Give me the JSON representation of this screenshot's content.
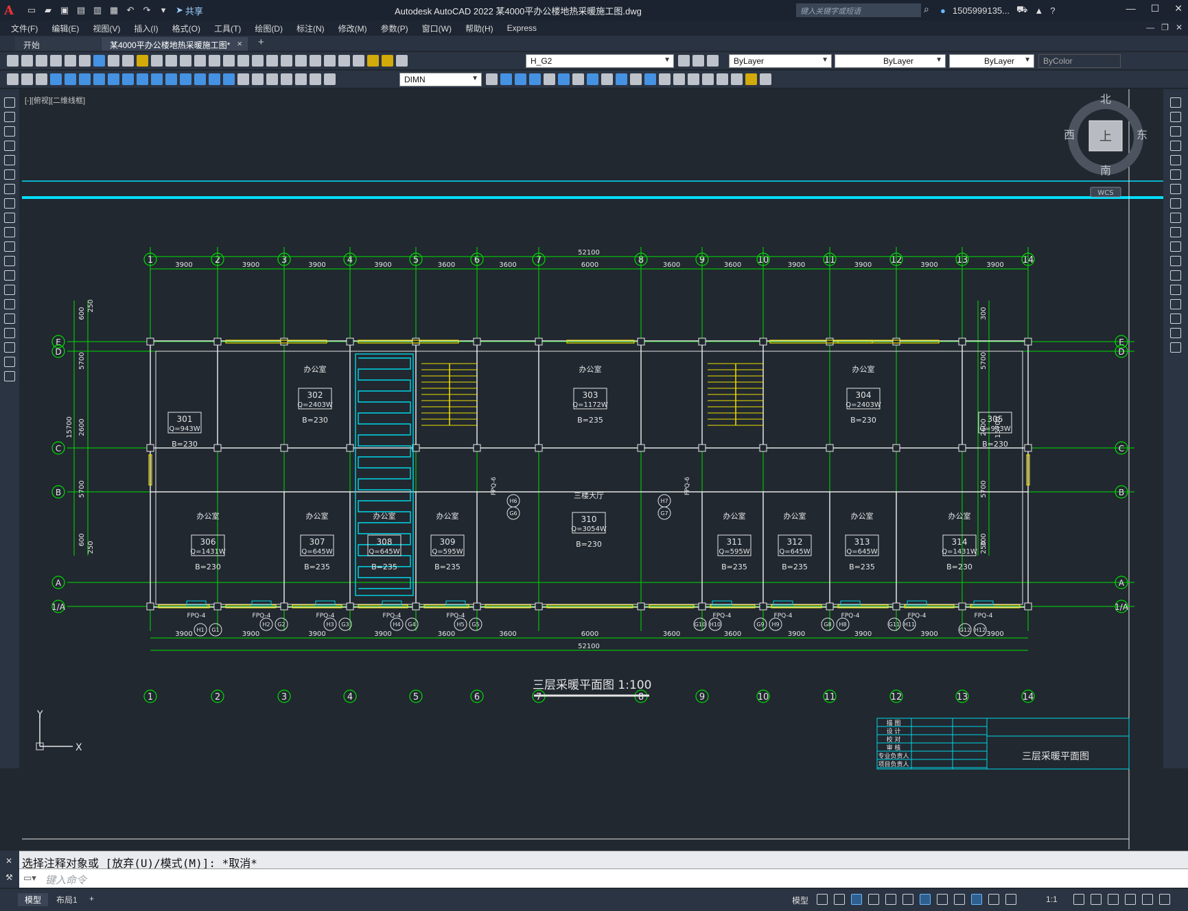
{
  "titlebar": {
    "logo": "A",
    "share_label": "共享",
    "app_title": "Autodesk AutoCAD 2022    某4000平办公楼地热采暖施工图.dwg",
    "search_placeholder": "键入关键字或短语",
    "user": "1505999135...",
    "win_min": "—",
    "win_max": "☐",
    "win_close": "✕"
  },
  "menubar": {
    "items": [
      "文件(F)",
      "编辑(E)",
      "视图(V)",
      "插入(I)",
      "格式(O)",
      "工具(T)",
      "绘图(D)",
      "标注(N)",
      "修改(M)",
      "参数(P)",
      "窗口(W)",
      "帮助(H)",
      "Express"
    ]
  },
  "tabs": {
    "start": "开始",
    "active": "某4000平办公楼地热采暖施工图*",
    "close": "×",
    "add": "+"
  },
  "toolbar": {
    "layer_name": "H_G2",
    "color": "ByLayer",
    "linetype": "ByLayer",
    "lineweight": "ByLayer",
    "plotstyle": "ByColor",
    "dimstyle": "DIMN"
  },
  "viewport": {
    "view_label": "[-][俯视][二维线框]",
    "compass": {
      "north": "北",
      "south": "南",
      "east": "东",
      "west": "西",
      "top": "上",
      "wcs": "WCS"
    },
    "ucs": {
      "x": "X",
      "y": "Y"
    }
  },
  "drawing": {
    "grid_cols": [
      "1",
      "2",
      "3",
      "4",
      "5",
      "6",
      "7",
      "8",
      "9",
      "10",
      "11",
      "12",
      "13",
      "14"
    ],
    "grid_rows": [
      "E",
      "D",
      "C",
      "B",
      "A",
      "1/A"
    ],
    "top_total": "52100",
    "bottom_total": "52100",
    "spans": [
      "3900",
      "3900",
      "3900",
      "3900",
      "3600",
      "3600",
      "6000",
      "3600",
      "3600",
      "3900",
      "3900",
      "3900",
      "3900"
    ],
    "left_dims": [
      "250",
      "600",
      "5700",
      "2600",
      "5700",
      "600",
      "250"
    ],
    "left_total": "15700",
    "right_dims": [
      "300",
      "5700",
      "2600",
      "5700",
      "300",
      "250"
    ],
    "right_total": "15700",
    "rooms_top": [
      {
        "label": "办公室",
        "id": "302",
        "q": "Q=2403W",
        "b": "B=230"
      },
      {
        "label": "办公室",
        "id": "303",
        "q": "Q=1172W",
        "b": "B=235"
      },
      {
        "label": "办公室",
        "id": "304",
        "q": "Q=2403W",
        "b": "B=230"
      }
    ],
    "rooms_wc": [
      {
        "id": "301",
        "q": "Q=943W",
        "b": "B=230"
      },
      {
        "id": "305",
        "q": "Q=943W",
        "b": "B=230"
      }
    ],
    "hall": {
      "label": "三楼大厅",
      "id": "310",
      "q": "Q=3054W",
      "b": "B=230"
    },
    "rooms_bottom": [
      {
        "label": "办公室",
        "id": "306",
        "q": "Q=1431W",
        "b": "B=230"
      },
      {
        "label": "办公室",
        "id": "307",
        "q": "Q=645W",
        "b": "B=235"
      },
      {
        "label": "办公室",
        "id": "308",
        "q": "Q=645W",
        "b": "B=235"
      },
      {
        "label": "办公室",
        "id": "309",
        "q": "Q=595W",
        "b": "B=235"
      },
      {
        "label": "办公室",
        "id": "311",
        "q": "Q=595W",
        "b": "B=235"
      },
      {
        "label": "办公室",
        "id": "312",
        "q": "Q=645W",
        "b": "B=235"
      },
      {
        "label": "办公室",
        "id": "313",
        "q": "Q=645W",
        "b": "B=235"
      },
      {
        "label": "办公室",
        "id": "314",
        "q": "Q=1431W",
        "b": "B=230"
      }
    ],
    "fpq_bottom": [
      "FPQ-4",
      "FPQ-4",
      "FPQ-4",
      "FPQ-4",
      "FPQ-4",
      "FPQ-4",
      "FPQ-4",
      "FPQ-4",
      "FPQ-4",
      "FPQ-4"
    ],
    "fpq_mid": "FPQ-6",
    "pipe_tags": [
      "H1",
      "G1",
      "H2",
      "G2",
      "H3",
      "G3",
      "H4",
      "G4",
      "H5",
      "G5",
      "G10",
      "H10",
      "G9",
      "H9",
      "G8",
      "H8",
      "G11",
      "H11",
      "G12",
      "H12",
      "H6",
      "G6",
      "H7",
      "G7"
    ],
    "plan_title": "三层采暖平面图 1:100"
  },
  "titleblock": {
    "rows": [
      "描 图",
      "设 计",
      "校 对",
      "审 核",
      "专业负责人",
      "项目负责人"
    ],
    "drawing_name": "三层采暖平面图"
  },
  "command": {
    "history": "选择注释对象或 [放弃(U)/模式(M)]: *取消*",
    "placeholder": "键入命令"
  },
  "statusbar": {
    "tabs": [
      "模型",
      "布局1"
    ],
    "add": "+",
    "model_label": "模型",
    "scale": "1:1"
  }
}
